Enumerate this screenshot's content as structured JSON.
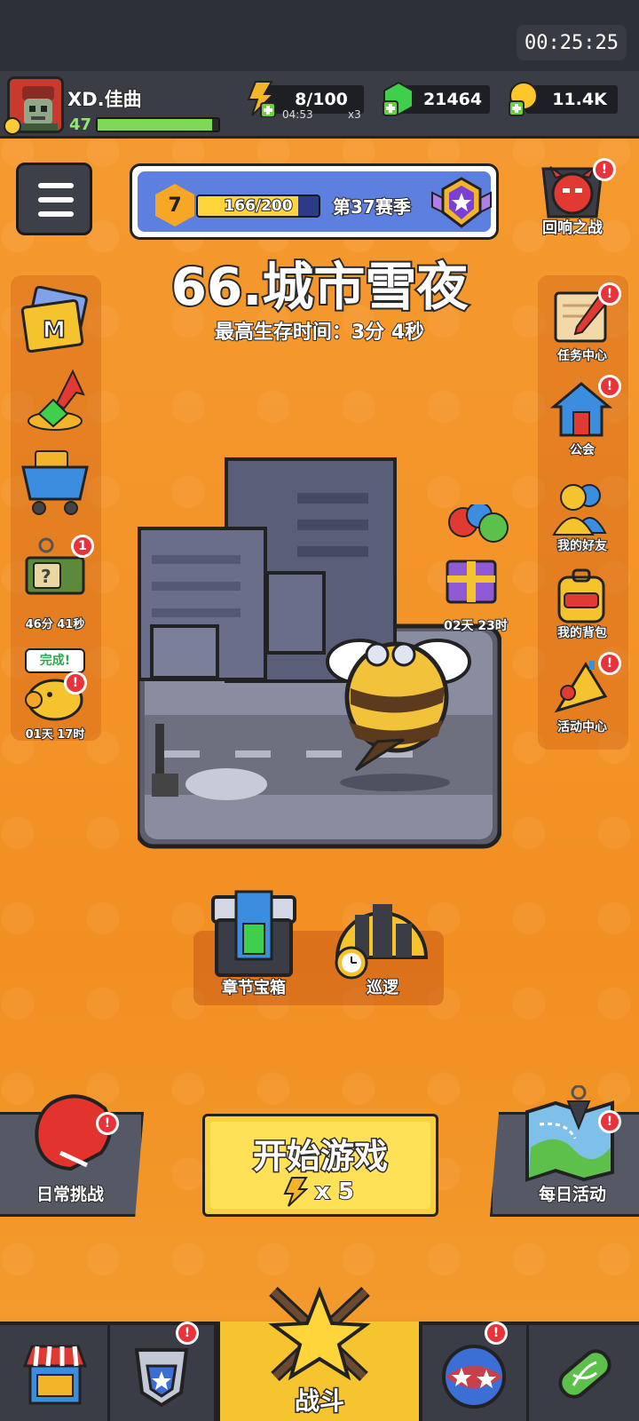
{
  "clock": "00:25:25",
  "player": {
    "name": "XD.佳曲",
    "level": "47",
    "xp_fraction": 0.95
  },
  "resources": {
    "energy": {
      "value": "8/100",
      "timer": "04:53",
      "multiplier": "x3"
    },
    "gems": {
      "value": "21464"
    },
    "coins": {
      "value": "11.4K"
    }
  },
  "season": {
    "level": "7",
    "progress_text": "166/200",
    "progress_fraction": 0.83,
    "title": "第37赛季"
  },
  "echo_battle": {
    "label": "回响之战"
  },
  "stage": {
    "title": "66.城市雪夜",
    "best_time": "最高生存时间：3分 4秒"
  },
  "left_side": {
    "crate": {
      "badge": "1",
      "timer": "46分 41秒"
    },
    "piggy": {
      "bubble": "完成!",
      "timer": "01天 17时"
    }
  },
  "gift": {
    "timer": "02天 23时"
  },
  "right_side": [
    {
      "label": "任务中心"
    },
    {
      "label": "公会"
    },
    {
      "label": "我的好友"
    },
    {
      "label": "我的背包"
    },
    {
      "label": "活动中心"
    }
  ],
  "chapter": {
    "chest_label": "章节宝箱",
    "patrol_label": "巡逻"
  },
  "actions": {
    "daily_challenge": "日常挑战",
    "start_game": "开始游戏",
    "energy_cost": "x 5",
    "daily_event": "每日活动"
  },
  "nav": {
    "battle": "战斗"
  },
  "colors": {
    "accent_orange": "#f4962a",
    "badge_red": "#e8333a",
    "start_yellow": "#ffe157",
    "nav_dark": "#3a3c46"
  }
}
